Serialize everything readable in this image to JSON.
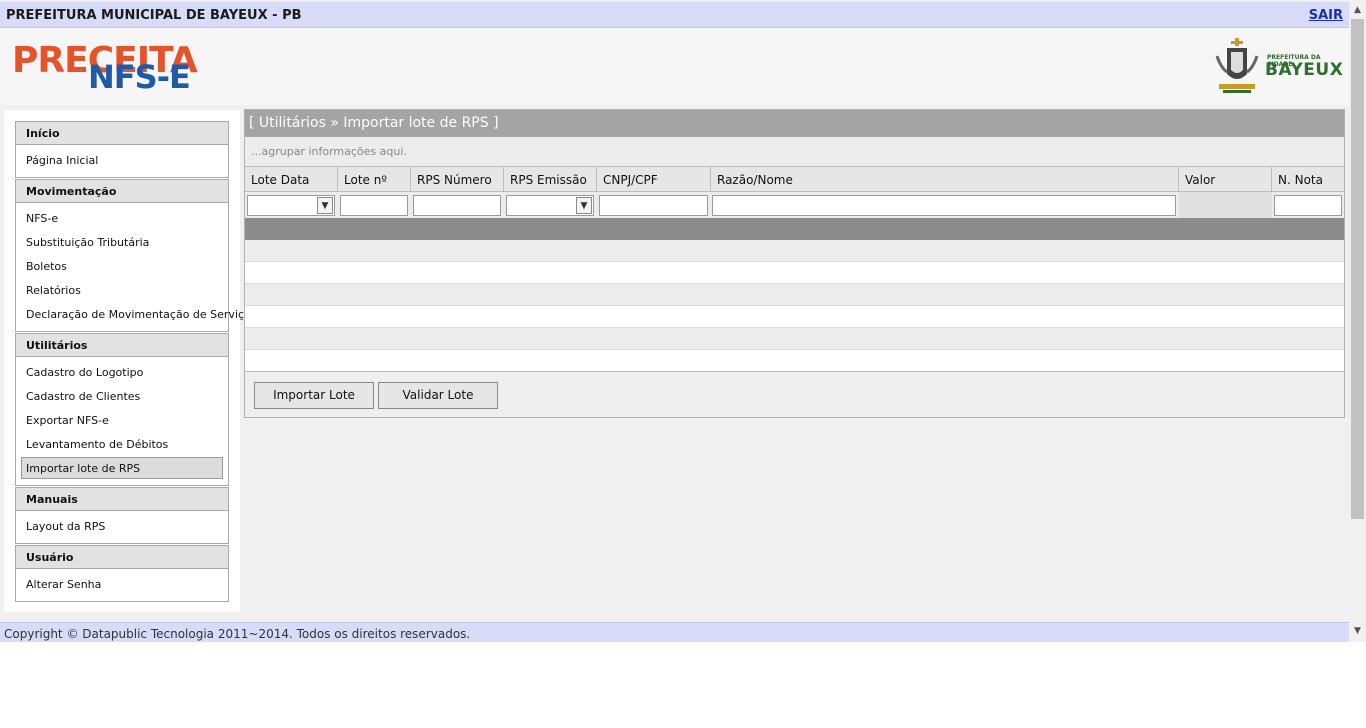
{
  "topbar": {
    "title": "PREFEITURA MUNICIPAL DE BAYEUX - PB",
    "logout": "SAIR"
  },
  "brand": {
    "logo_line1": "PRECEITA",
    "logo_line2": "NFS-E",
    "city_small": "PREFEITURA DA CIDADE",
    "city_big": "BAYEUX",
    "city_color": "#2e6e2e",
    "logo_red": "#e4532a",
    "logo_blue": "#1f5aa8"
  },
  "sidebar": {
    "sections": [
      {
        "title": "Início",
        "items": [
          "Página Inicial"
        ]
      },
      {
        "title": "Movimentação",
        "items": [
          "NFS-e",
          "Substituição Tributária",
          "Boletos",
          "Relatórios",
          "Declaração de Movimentação de Serviço"
        ]
      },
      {
        "title": "Utilitários",
        "items": [
          "Cadastro do Logotipo",
          "Cadastro de Clientes",
          "Exportar NFS-e",
          "Levantamento de Débitos",
          "Importar lote de RPS"
        ]
      },
      {
        "title": "Manuais",
        "items": [
          "Layout da RPS"
        ]
      },
      {
        "title": "Usuário",
        "items": [
          "Alterar Senha"
        ]
      }
    ]
  },
  "main": {
    "title": "[ Utilitários » Importar lote de RPS ]",
    "group_hint": "...agrupar informações aqui.",
    "columns": [
      "Lote Data",
      "Lote nº",
      "RPS Número",
      "RPS Emissão",
      "CNPJ/CPF",
      "Razão/Nome",
      "Valor",
      "N. Nota"
    ],
    "buttons": {
      "import": "Importar Lote",
      "validate": "Validar Lote"
    }
  },
  "footer": {
    "text": "Copyright © Datapublic Tecnologia 2011~2014. Todos os direitos reservados."
  }
}
